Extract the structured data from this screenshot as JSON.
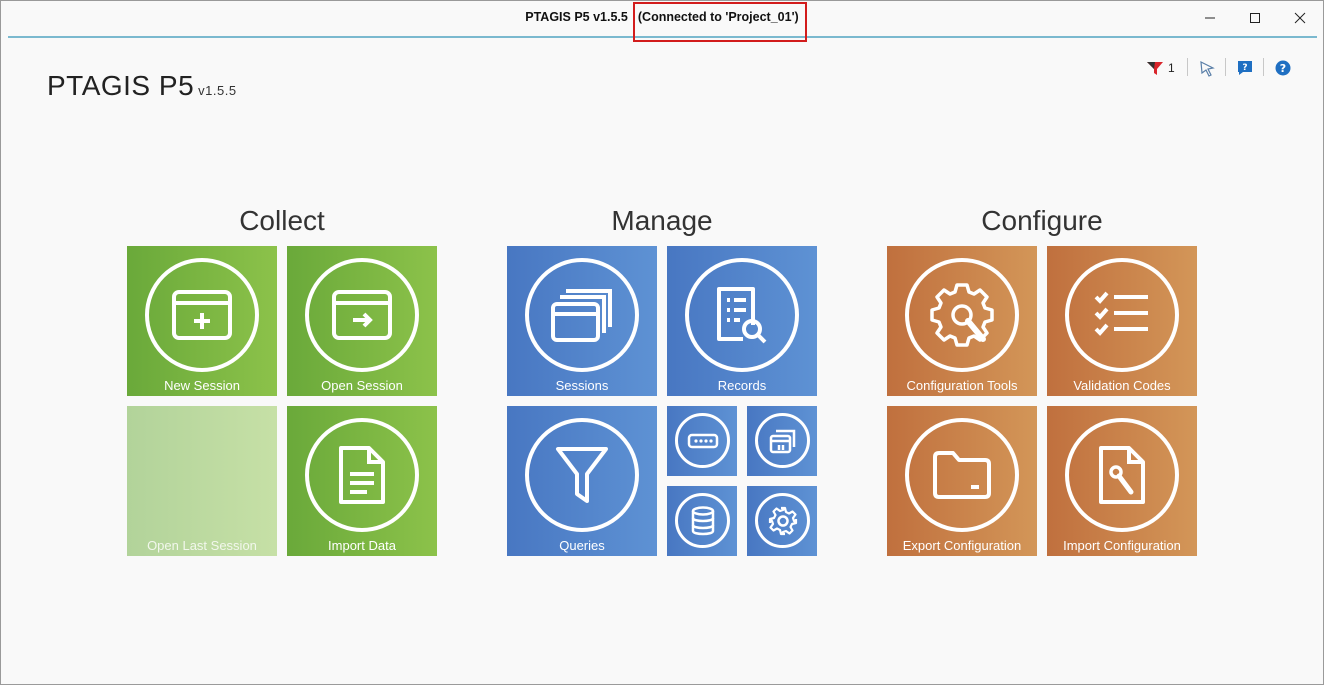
{
  "window": {
    "title": "PTAGIS P5 v1.5.5",
    "connection": "(Connected to 'Project_01')"
  },
  "app": {
    "name": "PTAGIS P5",
    "version": "v1.5.5"
  },
  "toolbar": {
    "filter_count": "1",
    "icons": [
      "filter-flag-icon",
      "cursor-tool-icon",
      "help-chat-icon",
      "help-icon"
    ]
  },
  "sections": {
    "collect": {
      "title": "Collect",
      "tiles": {
        "new_session": "New Session",
        "open_session": "Open Session",
        "open_last_session": "Open Last Session",
        "import_data": "Import Data"
      }
    },
    "manage": {
      "title": "Manage",
      "tiles": {
        "sessions": "Sessions",
        "records": "Records",
        "queries": "Queries"
      }
    },
    "configure": {
      "title": "Configure",
      "tiles": {
        "configuration_tools": "Configuration Tools",
        "validation_codes": "Validation Codes",
        "export_configuration": "Export Configuration",
        "import_configuration": "Import Configuration"
      }
    }
  },
  "colors": {
    "collect": "#7ab642",
    "manage": "#5384cb",
    "configure": "#c8804a",
    "highlight": "#d21c1c",
    "accent_line": "#7bb9cf"
  }
}
